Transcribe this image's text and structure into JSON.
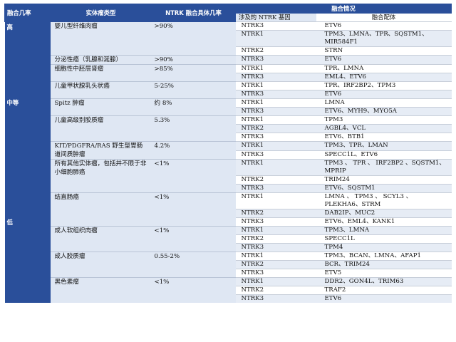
{
  "header": {
    "col_level": "融合几率",
    "col_tumor": "实体瘤类型",
    "col_pct": "NTRK 融合具体几率",
    "col_fusion": "融合情况",
    "sub_gene": "涉及的 NTRK 基因",
    "sub_partner": "融合配体"
  },
  "levels": {
    "high": "高",
    "mid": "中等",
    "low": "低"
  },
  "rows": [
    {
      "tumor": "婴儿型纤维肉瘤",
      "pct": ">90%",
      "gene": "NTRK3",
      "partner": "ETV6"
    },
    {
      "gene": "NTRK1",
      "partner": "TPM3、LMNA、TPR、SQSTM1、MIR584F1"
    },
    {
      "gene": "NTRK2",
      "partner": "STRN"
    },
    {
      "tumor": "分泌性癌（乳腺和涎腺）",
      "pct": ">90%",
      "gene": "NTRK3",
      "partner": "ETV6"
    },
    {
      "tumor": "细胞性中胚层肾瘤",
      "pct": ">85%",
      "gene": "NTRK1",
      "partner": "TPR、LMNA"
    },
    {
      "gene": "NTRK3",
      "partner": "EML4、ETV6"
    },
    {
      "tumor": "儿童甲状腺乳头状癌",
      "pct": "5-25%",
      "gene": "NTRK1",
      "partner": "TPR、IRF2BP2、TPM3"
    },
    {
      "gene": "NTRK3",
      "partner": "ETV6"
    },
    {
      "tumor": "Spitz 肿瘤",
      "pct": "约 8%",
      "gene": "NTRK1",
      "partner": "LMNA"
    },
    {
      "gene": "NTRK3",
      "partner": "ETV6、MYH9、MYO5A"
    },
    {
      "tumor": "儿童高级别胶质瘤",
      "pct": "5.3%",
      "gene": "NTRK1",
      "partner": "TPM3"
    },
    {
      "gene": "NTRK2",
      "partner": "AGBL4、VCL"
    },
    {
      "gene": "NTRK3",
      "partner": "ETV6、BTB1"
    },
    {
      "tumor": "KIT/PDGFRA/RAS 野生型胃肠道间质肿瘤",
      "pct": "4.2%",
      "gene": "NTRK1",
      "partner": "TPM3、TPR、LMAN"
    },
    {
      "gene": "NTRK3",
      "partner": "SPECC1L、ETV6"
    },
    {
      "tumor": "所有其他实体瘤，包括并不限于非小细胞肺癌",
      "pct": "<1%",
      "gene": "NTRK1",
      "partner": "TPM3 、 TPR 、 IRF2BP2 、SQSTM1、MPRIP"
    },
    {
      "gene": "NTRK2",
      "partner": "TRIM24"
    },
    {
      "gene": "NTRK3",
      "partner": "ETV6、SQSTM1"
    },
    {
      "tumor": "结直肠癌",
      "pct": "<1%",
      "gene": "NTRK1",
      "partner": "LMNA 、 TPM3 、 SCYL3 、PLEKHA6、STRM"
    },
    {
      "gene": "NTRK2",
      "partner": "DAB2IP、MUC2"
    },
    {
      "gene": "NTRK3",
      "partner": "ETV6、EML4、KANK1"
    },
    {
      "tumor": "成人软组织肉瘤",
      "pct": "<1%",
      "gene": "NTRK1",
      "partner": "TPM3、LMNA"
    },
    {
      "gene": "NTRK2",
      "partner": "SPECC1L"
    },
    {
      "gene": "NTRK3",
      "partner": "TPM4"
    },
    {
      "tumor": "成人胶质瘤",
      "pct": "0.55-2%",
      "gene": "NTRK1",
      "partner": "TPM3、BCAN、LMNA、AFAP1"
    },
    {
      "gene": "NTRK2",
      "partner": "BCR、TRIM24"
    },
    {
      "gene": "NTRK3",
      "partner": "ETV5"
    },
    {
      "tumor": "黑色素瘤",
      "pct": "<1%",
      "gene": "NTRK1",
      "partner": "DDR2、GON4L、TRIM63"
    },
    {
      "gene": "NTRK2",
      "partner": "TRAF2"
    },
    {
      "gene": "NTRK3",
      "partner": "ETV6"
    }
  ],
  "colors": {
    "header_bg": "#2a4f9a",
    "light_cell": "#dfe7f3"
  }
}
